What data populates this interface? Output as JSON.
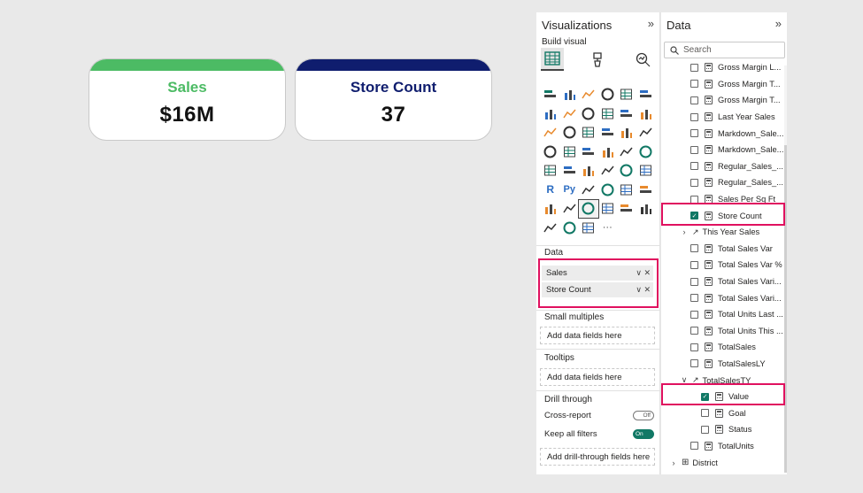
{
  "cards": [
    {
      "title": "Sales",
      "value": "$16M",
      "accent": "#4cbb64"
    },
    {
      "title": "Store Count",
      "value": "37",
      "accent": "#0f1d6e"
    }
  ],
  "viz": {
    "title": "Visualizations",
    "build_label": "Build visual",
    "data_section": "Data",
    "fields": [
      {
        "label": "Sales"
      },
      {
        "label": "Store Count"
      }
    ],
    "small_multiples": "Small multiples",
    "small_multiples_placeholder": "Add data fields here",
    "tooltips": "Tooltips",
    "tooltips_placeholder": "Add data fields here",
    "drill_through": "Drill through",
    "cross_report": "Cross-report",
    "cross_report_state": "Off",
    "keep_filters": "Keep all filters",
    "keep_filters_state": "On",
    "drill_placeholder": "Add drill-through fields here",
    "more_icon": "···"
  },
  "data_pane": {
    "title": "Data",
    "search_placeholder": "Search",
    "items": [
      {
        "label": "Gross Margin L...",
        "type": "measure",
        "checked": false
      },
      {
        "label": "Gross Margin T...",
        "type": "measure",
        "checked": false
      },
      {
        "label": "Gross Margin T...",
        "type": "measure",
        "checked": false
      },
      {
        "label": "Last Year Sales",
        "type": "measure",
        "checked": false
      },
      {
        "label": "Markdown_Sale...",
        "type": "measure",
        "checked": false
      },
      {
        "label": "Markdown_Sale...",
        "type": "measure",
        "checked": false
      },
      {
        "label": "Regular_Sales_...",
        "type": "measure",
        "checked": false
      },
      {
        "label": "Regular_Sales_...",
        "type": "measure",
        "checked": false
      },
      {
        "label": "Sales Per Sq Ft",
        "type": "measure",
        "checked": false
      },
      {
        "label": "Store Count",
        "type": "measure",
        "checked": true
      },
      {
        "label": "This Year Sales",
        "type": "group",
        "expanded": false
      },
      {
        "label": "Total Sales Var",
        "type": "measure",
        "checked": false
      },
      {
        "label": "Total Sales Var %",
        "type": "measure",
        "checked": false
      },
      {
        "label": "Total Sales Vari...",
        "type": "measure",
        "checked": false
      },
      {
        "label": "Total Sales Vari...",
        "type": "measure",
        "checked": false
      },
      {
        "label": "Total Units Last ...",
        "type": "measure",
        "checked": false
      },
      {
        "label": "Total Units This ...",
        "type": "measure",
        "checked": false
      },
      {
        "label": "TotalSales",
        "type": "measure",
        "checked": false
      },
      {
        "label": "TotalSalesLY",
        "type": "measure",
        "checked": false
      },
      {
        "label": "TotalSalesTY",
        "type": "kpi",
        "expanded": true
      },
      {
        "label": "Value",
        "type": "child",
        "checked": true
      },
      {
        "label": "Goal",
        "type": "child",
        "checked": false
      },
      {
        "label": "Status",
        "type": "child",
        "checked": false
      },
      {
        "label": "TotalUnits",
        "type": "measure",
        "checked": false
      },
      {
        "label": "District",
        "type": "table",
        "expanded": false
      }
    ]
  },
  "colors": {
    "highlight": "#e0115f",
    "accent_green": "#117865"
  }
}
